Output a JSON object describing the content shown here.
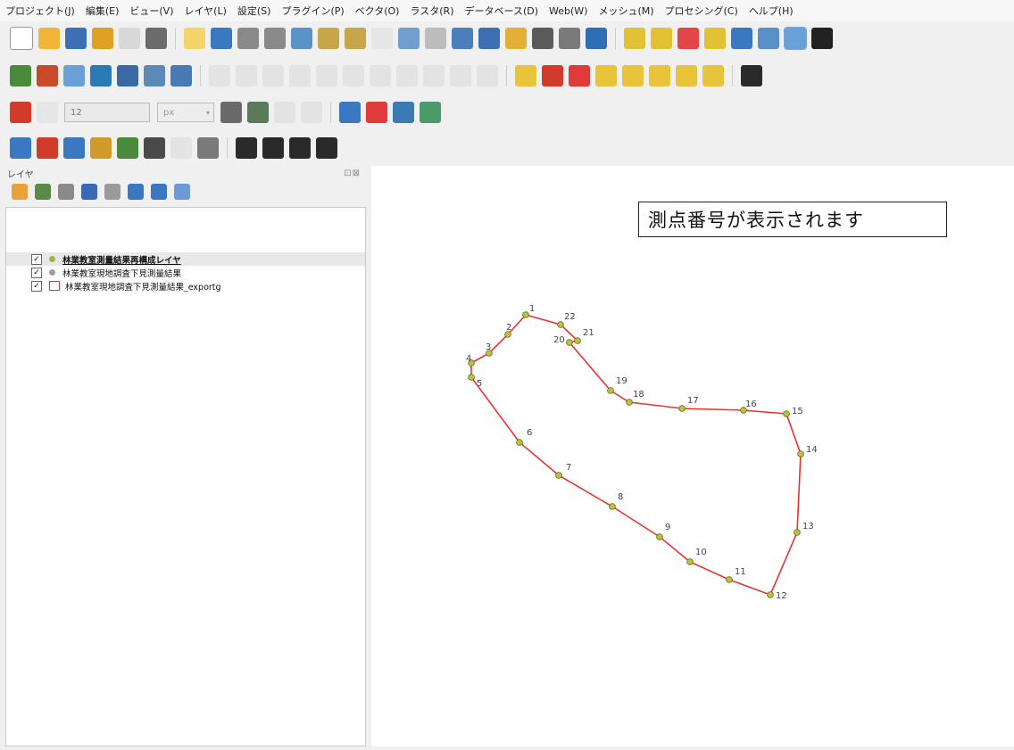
{
  "menubar": {
    "items": [
      "プロジェクト(J)",
      "編集(E)",
      "ビュー(V)",
      "レイヤ(L)",
      "設定(S)",
      "プラグイン(P)",
      "ベクタ(O)",
      "ラスタ(R)",
      "データベース(D)",
      "Web(W)",
      "メッシュ(M)",
      "プロセシング(C)",
      "ヘルプ(H)"
    ]
  },
  "toolbars": {
    "row1": [
      {
        "name": "new-project-icon",
        "color": "#ffffff"
      },
      {
        "name": "open-project-icon",
        "color": "#f1b53a"
      },
      {
        "name": "save-project-icon",
        "color": "#3d6fb4"
      },
      {
        "name": "save-as-icon",
        "color": "#e0a020"
      },
      {
        "name": "print-layout-icon",
        "color": "#d8d8d8"
      },
      {
        "name": "style-manager-icon",
        "color": "#6b6b6b"
      },
      {
        "name": "pan-map-icon",
        "color": "#f3d36a"
      },
      {
        "name": "pan-to-selection-icon",
        "color": "#3b78c2"
      },
      {
        "name": "zoom-in-icon",
        "color": "#8a8a8a"
      },
      {
        "name": "zoom-out-icon",
        "color": "#8a8a8a"
      },
      {
        "name": "zoom-full-icon",
        "color": "#5a92c9"
      },
      {
        "name": "zoom-to-selection-icon",
        "color": "#c8a64a"
      },
      {
        "name": "zoom-to-layer-icon",
        "color": "#c8a64a"
      },
      {
        "name": "zoom-native-icon",
        "color": "#cfcfcf"
      },
      {
        "name": "zoom-last-icon",
        "color": "#6f9fcf"
      },
      {
        "name": "zoom-next-icon",
        "color": "#bcbcbc"
      },
      {
        "name": "new-map-view-icon",
        "color": "#4d7fbf"
      },
      {
        "name": "new-3d-view-icon",
        "color": "#3d6fb4"
      },
      {
        "name": "new-bookmark-icon",
        "color": "#e3b035"
      },
      {
        "name": "show-bookmarks-icon",
        "color": "#5a5a5a"
      },
      {
        "name": "temporal-controller-icon",
        "color": "#7a7a7a"
      },
      {
        "name": "refresh-icon",
        "color": "#2f6db5"
      },
      {
        "name": "select-features-icon",
        "color": "#e2c234"
      },
      {
        "name": "select-by-value-icon",
        "color": "#e2c234"
      },
      {
        "name": "deselect-icon",
        "color": "#e24545"
      },
      {
        "name": "select-location-icon",
        "color": "#e2c234"
      },
      {
        "name": "identify-icon",
        "color": "#3b78c2"
      },
      {
        "name": "attribute-table-icon",
        "color": "#5b8fc9"
      },
      {
        "name": "statistics-icon",
        "color": "#6aa0d8"
      },
      {
        "name": "sum-icon",
        "color": "#222222"
      }
    ],
    "row2": [
      {
        "name": "add-vector-layer-icon",
        "color": "#4a8a3a"
      },
      {
        "name": "add-raster-layer-icon",
        "color": "#c84a2a"
      },
      {
        "name": "add-delimited-text-icon",
        "color": "#6aa0d8"
      },
      {
        "name": "add-gps-icon",
        "color": "#2a7ab5"
      },
      {
        "name": "add-spatialite-icon",
        "color": "#3a6aa5"
      },
      {
        "name": "add-wms-icon",
        "color": "#5a8ab5"
      },
      {
        "name": "add-wfs-icon",
        "color": "#4a7ab5"
      },
      {
        "name": "current-edits-icon",
        "color": "#c8c8c8"
      },
      {
        "name": "toggle-editing-icon",
        "color": "#c8c8c8"
      },
      {
        "name": "save-edits-icon",
        "color": "#c8c8c8"
      },
      {
        "name": "add-feature-icon",
        "color": "#c8c8c8"
      },
      {
        "name": "vertex-tool-icon",
        "color": "#c8c8c8"
      },
      {
        "name": "delete-selected-icon",
        "color": "#c8c8c8"
      },
      {
        "name": "cut-features-icon",
        "color": "#c8c8c8"
      },
      {
        "name": "copy-features-icon",
        "color": "#c8c8c8"
      },
      {
        "name": "paste-features-icon",
        "color": "#c8c8c8"
      },
      {
        "name": "undo-icon",
        "color": "#c8c8c8"
      },
      {
        "name": "redo-icon",
        "color": "#c8c8c8"
      },
      {
        "name": "label-tool-icon",
        "color": "#e8c43a"
      },
      {
        "name": "diagram-tool-icon",
        "color": "#d23a2a"
      },
      {
        "name": "pin-labels-icon",
        "color": "#e03a3a"
      },
      {
        "name": "highlight-labels-icon",
        "color": "#e8c43a"
      },
      {
        "name": "show-hide-labels-icon",
        "color": "#e8c43a"
      },
      {
        "name": "move-label-icon",
        "color": "#e8c43a"
      },
      {
        "name": "rotate-label-icon",
        "color": "#e8c43a"
      },
      {
        "name": "change-label-icon",
        "color": "#e8c43a"
      },
      {
        "name": "python-console-icon",
        "color": "#2a2a2a"
      }
    ],
    "row3": {
      "icons_before": [
        {
          "name": "snapping-magnet-icon",
          "color": "#d23a2a"
        },
        {
          "name": "snapping-layer-icon",
          "color": "#cfcfcf"
        }
      ],
      "tolerance_value": "12",
      "unit_value": "px",
      "icons_after": [
        {
          "name": "topological-editing-icon",
          "color": "#6a6a6a"
        },
        {
          "name": "snapping-intersection-icon",
          "color": "#5a7a5a"
        },
        {
          "name": "tracing-icon",
          "color": "#c8c8c8"
        },
        {
          "name": "digitize-curve-icon",
          "color": "#c8c8c8"
        },
        {
          "name": "python-icon",
          "color": "#3a78c2"
        },
        {
          "name": "location-pin-icon",
          "color": "#e23a3a"
        },
        {
          "name": "xml-import-icon",
          "color": "#3a7ab5"
        },
        {
          "name": "map-import-icon",
          "color": "#4a9a6a"
        }
      ]
    },
    "row4": [
      {
        "name": "copy-layer-style-icon",
        "color": "#3a78c2"
      },
      {
        "name": "pin-icon",
        "color": "#d23a2a"
      },
      {
        "name": "search-icon",
        "color": "#3a78c2"
      },
      {
        "name": "zoom-point-icon",
        "color": "#d29a2a"
      },
      {
        "name": "bounding-box-icon",
        "color": "#4a8a3a"
      },
      {
        "name": "globe-icon",
        "color": "#4a4a4a"
      },
      {
        "name": "network-icon",
        "color": "#c8c8c8"
      },
      {
        "name": "wrench-icon",
        "color": "#7a7a7a"
      },
      {
        "name": "anchor-icon",
        "color": "#2a2a2a"
      },
      {
        "name": "select-cursor-icon",
        "color": "#2a2a2a"
      },
      {
        "name": "swap-arrows-icon",
        "color": "#2a2a2a"
      },
      {
        "name": "download-icon",
        "color": "#2a2a2a"
      }
    ]
  },
  "layers_panel": {
    "title": "レイヤ",
    "title_buttons": "⊡⊠",
    "layers": [
      {
        "label": "林業教室測量結果再構成レイヤ",
        "checked": "✓",
        "symbol": "dot",
        "color": "#9ab83a",
        "selected": true
      },
      {
        "label": "林業教室現地調査下見測量結果",
        "checked": "✓",
        "symbol": "dot",
        "color": "#9aa09a",
        "selected": false
      },
      {
        "label": "林業教室現地調査下見測量結果_exportg",
        "checked": "✓",
        "symbol": "poly",
        "color": "#e33333",
        "selected": false
      }
    ]
  },
  "map": {
    "callout_text": "測点番号が表示されます",
    "line_color": "#e8332f",
    "point_fill": "#b8c23a",
    "point_stroke": "#6a6a20",
    "points": [
      {
        "label": "1"
      },
      {
        "label": "2"
      },
      {
        "label": "3"
      },
      {
        "label": "4"
      },
      {
        "label": "5"
      },
      {
        "label": "6"
      },
      {
        "label": "7"
      },
      {
        "label": "8"
      },
      {
        "label": "9"
      },
      {
        "label": "10"
      },
      {
        "label": "11"
      },
      {
        "label": "12"
      },
      {
        "label": "13"
      },
      {
        "label": "14"
      },
      {
        "label": "15"
      },
      {
        "label": "16"
      },
      {
        "label": "17"
      },
      {
        "label": "18"
      },
      {
        "label": "19"
      },
      {
        "label": "20"
      },
      {
        "label": "21"
      },
      {
        "label": "22"
      }
    ]
  }
}
